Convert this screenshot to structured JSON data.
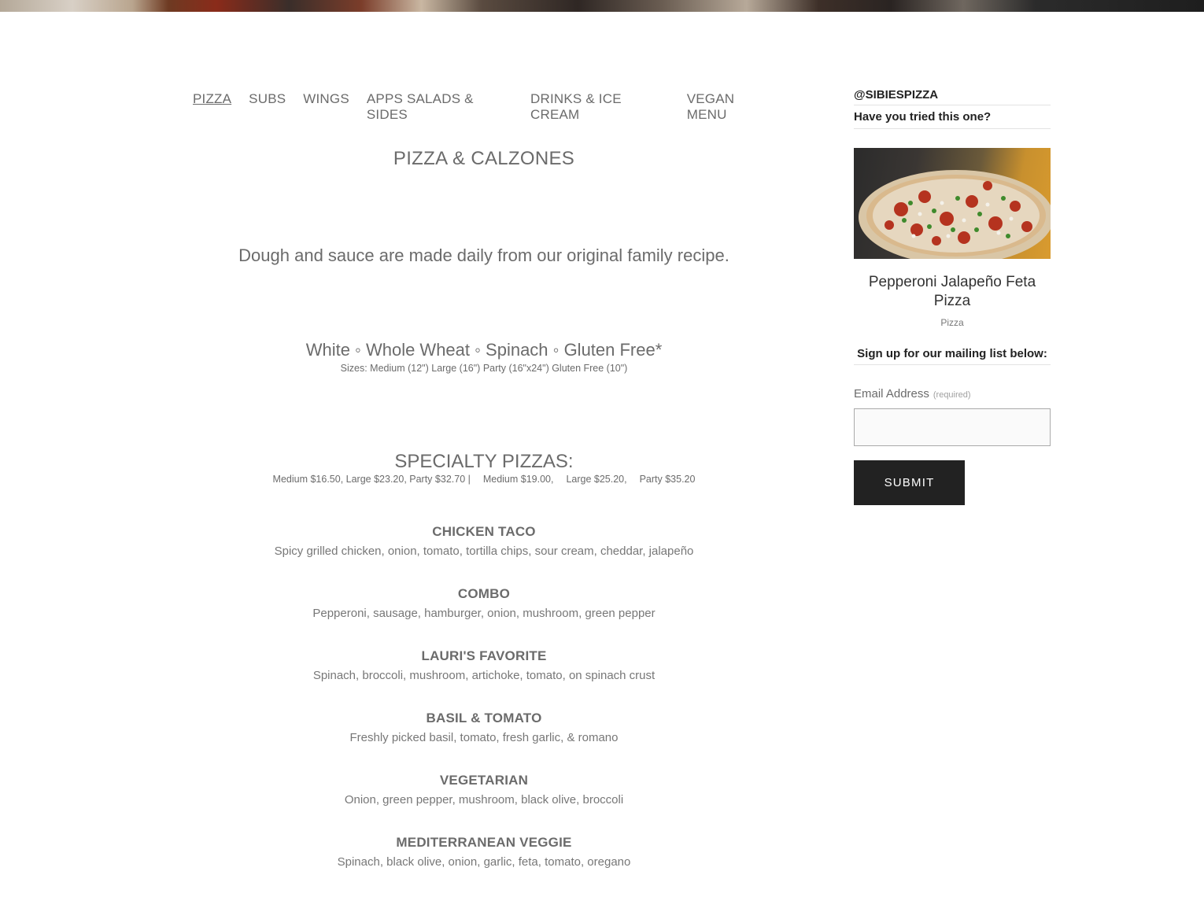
{
  "nav": [
    {
      "label": "PIZZA",
      "active": true
    },
    {
      "label": "SUBS",
      "active": false
    },
    {
      "label": "WINGS",
      "active": false
    },
    {
      "label": "APPS SALADS & SIDES",
      "active": false
    },
    {
      "label": "DRINKS & ICE CREAM",
      "active": false
    },
    {
      "label": "VEGAN MENU",
      "active": false
    }
  ],
  "menu": {
    "section_title": "PIZZA & CALZONES",
    "intro": "Dough and sauce are made daily from our original family recipe.",
    "crusts": "White ◦ Whole Wheat ◦ Spinach ◦ Gluten Free*",
    "sizes": "Sizes: Medium (12\") Large (16\") Party (16\"x24\") Gluten Free (10\")",
    "specialty_title": "SPECIALTY PIZZAS:",
    "specialty_prices": "Medium $16.50, Large $23.20, Party $32.70 |  Medium $19.00,  Large $25.20,  Party $35.20",
    "items": [
      {
        "name": "CHICKEN TACO",
        "desc": "Spicy grilled chicken, onion, tomato, tortilla chips, sour cream, cheddar, jalapeño"
      },
      {
        "name": "COMBO",
        "desc": "Pepperoni, sausage, hamburger, onion, mushroom, green pepper"
      },
      {
        "name": "LAURI'S FAVORITE",
        "desc": "Spinach, broccoli, mushroom, artichoke, tomato, on spinach crust"
      },
      {
        "name": "BASIL & TOMATO",
        "desc": "Freshly picked basil, tomato, fresh garlic, & romano"
      },
      {
        "name": "VEGETARIAN",
        "desc": "Onion, green pepper, mushroom, black olive, broccoli"
      },
      {
        "name": "MEDITERRANEAN VEGGIE",
        "desc": "Spinach, black olive, onion, garlic, feta, tomato, oregano"
      }
    ]
  },
  "sidebar": {
    "handle": "@SIBIESPIZZA",
    "tried": "Have you tried this one?",
    "featured_name": "Pepperoni Jalapeño Feta Pizza",
    "featured_category": "Pizza",
    "mailing_title": "Sign up for our mailing list below:",
    "email_label": "Email Address",
    "email_required": "(required)",
    "email_value": "",
    "submit_label": "SUBMIT"
  },
  "colors": {
    "text": "#6b6b6b",
    "button_bg": "#222222",
    "button_text": "#ffffff"
  }
}
